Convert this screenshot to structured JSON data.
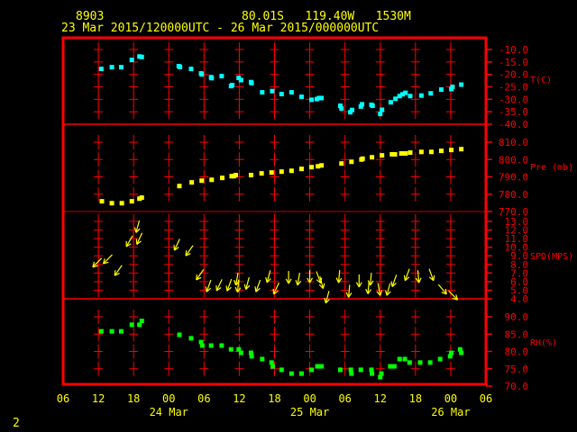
{
  "header": {
    "station": "8903",
    "location": "80.01S   119.40W   1530M",
    "time_range": "23 Mar 2015/120000UTC - 26 Mar 2015/000000UTC"
  },
  "page_number": "2",
  "colors": {
    "frame": "#ff0000",
    "text": "#ffff00",
    "temp": "#00ffff",
    "pressure": "#ffff00",
    "wind": "#ffff00",
    "rh": "#00ff00"
  },
  "chart_data": {
    "type": "scatter",
    "x_unit": "hours since 23 Mar 2015 06 UTC",
    "xlim": [
      0,
      72
    ],
    "x_ticks": [
      {
        "h": 0,
        "label": "06"
      },
      {
        "h": 6,
        "label": "12"
      },
      {
        "h": 12,
        "label": "18"
      },
      {
        "h": 18,
        "label": "00"
      },
      {
        "h": 24,
        "label": "06"
      },
      {
        "h": 30,
        "label": "12"
      },
      {
        "h": 36,
        "label": "18"
      },
      {
        "h": 42,
        "label": "00"
      },
      {
        "h": 48,
        "label": "06"
      },
      {
        "h": 54,
        "label": "12"
      },
      {
        "h": 60,
        "label": "18"
      },
      {
        "h": 66,
        "label": "00"
      },
      {
        "h": 72,
        "label": "06"
      }
    ],
    "date_labels": [
      {
        "h": 18,
        "label": "24 Mar"
      },
      {
        "h": 42,
        "label": "25 Mar"
      },
      {
        "h": 66,
        "label": "26 Mar"
      }
    ],
    "panels": [
      {
        "name": "temperature",
        "label": "T(C)",
        "ylim": [
          -40,
          -10
        ],
        "ticks": [
          "-10.0",
          "-15.0",
          "-20.0",
          "-25.0",
          "-30.0",
          "-35.0",
          "-40.0"
        ],
        "points": [
          [
            6.5,
            -17.8
          ],
          [
            8.3,
            -17.1
          ],
          [
            9.9,
            -17.1
          ],
          [
            11.7,
            -14.2
          ],
          [
            13.0,
            -12.8
          ],
          [
            13.4,
            -13.0
          ],
          [
            19.7,
            -16.7
          ],
          [
            19.9,
            -17.0
          ],
          [
            21.8,
            -17.8
          ],
          [
            23.5,
            -19.6
          ],
          [
            23.6,
            -20.0
          ],
          [
            25.2,
            -21.1
          ],
          [
            25.3,
            -21.5
          ],
          [
            27.0,
            -20.7
          ],
          [
            28.6,
            -24.7
          ],
          [
            28.8,
            -24.3
          ],
          [
            29.9,
            -21.4
          ],
          [
            30.3,
            -22.3
          ],
          [
            32.0,
            -23.1
          ],
          [
            32.1,
            -23.5
          ],
          [
            33.9,
            -27.2
          ],
          [
            35.6,
            -26.7
          ],
          [
            37.2,
            -27.9
          ],
          [
            38.9,
            -27.2
          ],
          [
            40.6,
            -29.0
          ],
          [
            42.3,
            -30.2
          ],
          [
            43.2,
            -29.9
          ],
          [
            43.6,
            -29.5
          ],
          [
            44.0,
            -29.5
          ],
          [
            47.2,
            -32.6
          ],
          [
            47.4,
            -33.7
          ],
          [
            48.9,
            -35.2
          ],
          [
            49.2,
            -34.3
          ],
          [
            50.7,
            -32.9
          ],
          [
            50.9,
            -32.0
          ],
          [
            52.5,
            -32.2
          ],
          [
            52.7,
            -32.6
          ],
          [
            54.0,
            -35.9
          ],
          [
            54.3,
            -34.2
          ],
          [
            55.8,
            -31.2
          ],
          [
            56.6,
            -29.8
          ],
          [
            57.3,
            -28.7
          ],
          [
            57.8,
            -28.0
          ],
          [
            58.3,
            -27.4
          ],
          [
            59.1,
            -28.7
          ],
          [
            61.0,
            -28.5
          ],
          [
            62.6,
            -27.6
          ],
          [
            64.4,
            -26.1
          ],
          [
            66.1,
            -25.9
          ],
          [
            66.3,
            -25.0
          ],
          [
            67.8,
            -24.1
          ]
        ]
      },
      {
        "name": "pressure",
        "label": "Pre (mb)",
        "ylim": [
          770,
          810
        ],
        "ticks": [
          "810.0",
          "800.0",
          "790.0",
          "780.0",
          "770.0"
        ],
        "points": [
          [
            6.6,
            775.9
          ],
          [
            8.3,
            774.8
          ],
          [
            10.0,
            774.8
          ],
          [
            11.7,
            775.9
          ],
          [
            13.0,
            777.4
          ],
          [
            13.4,
            778.0
          ],
          [
            19.8,
            784.7
          ],
          [
            21.9,
            786.8
          ],
          [
            23.6,
            787.8
          ],
          [
            25.3,
            788.3
          ],
          [
            27.1,
            789.4
          ],
          [
            28.7,
            790.4
          ],
          [
            29.1,
            790.4
          ],
          [
            29.4,
            791.0
          ],
          [
            32.0,
            791.0
          ],
          [
            33.8,
            792.0
          ],
          [
            35.5,
            792.5
          ],
          [
            37.2,
            793.0
          ],
          [
            38.9,
            793.5
          ],
          [
            40.6,
            794.6
          ],
          [
            42.3,
            795.6
          ],
          [
            43.4,
            796.1
          ],
          [
            44.0,
            796.6
          ],
          [
            47.4,
            797.7
          ],
          [
            49.1,
            798.7
          ],
          [
            50.8,
            800.0
          ],
          [
            51.0,
            800.5
          ],
          [
            52.6,
            801.3
          ],
          [
            54.3,
            802.4
          ],
          [
            56.0,
            803.0
          ],
          [
            56.5,
            803.0
          ],
          [
            57.6,
            803.5
          ],
          [
            58.3,
            803.5
          ],
          [
            59.1,
            804.0
          ],
          [
            61.0,
            804.4
          ],
          [
            62.7,
            804.4
          ],
          [
            64.4,
            805.0
          ],
          [
            66.1,
            805.5
          ],
          [
            67.8,
            806.0
          ]
        ]
      },
      {
        "name": "wind_speed",
        "label": "SPD(MPS)",
        "ylim": [
          4,
          13
        ],
        "ticks": [
          "13.0",
          "12.0",
          "11.0",
          "10.0",
          "9.0",
          "8.0",
          "7.0",
          "6.0",
          "5.0",
          "4.0"
        ],
        "points": [
          [
            5.8,
            8.2,
            225
          ],
          [
            7.6,
            8.6,
            225
          ],
          [
            9.4,
            7.3,
            215
          ],
          [
            11.3,
            10.7,
            210
          ],
          [
            12.7,
            12.4,
            195
          ],
          [
            13.0,
            11.0,
            205
          ],
          [
            19.4,
            10.3,
            205
          ],
          [
            21.5,
            9.6,
            215
          ],
          [
            23.3,
            6.8,
            215
          ],
          [
            24.8,
            5.5,
            200
          ],
          [
            26.6,
            5.6,
            205
          ],
          [
            28.3,
            5.6,
            200
          ],
          [
            29.6,
            6.3,
            190
          ],
          [
            29.8,
            5.5,
            185
          ],
          [
            31.4,
            5.8,
            195
          ],
          [
            33.2,
            5.5,
            200
          ],
          [
            35.0,
            6.6,
            195
          ],
          [
            36.3,
            5.2,
            205
          ],
          [
            38.4,
            6.5,
            180
          ],
          [
            40.1,
            6.3,
            190
          ],
          [
            42.0,
            6.6,
            180
          ],
          [
            43.5,
            6.5,
            160
          ],
          [
            44.0,
            5.9,
            165
          ],
          [
            45.0,
            4.2,
            195
          ],
          [
            47.0,
            6.6,
            185
          ],
          [
            48.7,
            4.9,
            185
          ],
          [
            50.4,
            6.1,
            180
          ],
          [
            52.0,
            5.3,
            185
          ],
          [
            52.4,
            6.3,
            185
          ],
          [
            53.8,
            5.1,
            170
          ],
          [
            55.4,
            5.1,
            195
          ],
          [
            56.4,
            6.1,
            200
          ],
          [
            58.6,
            6.8,
            200
          ],
          [
            60.5,
            6.6,
            175
          ],
          [
            62.7,
            6.8,
            160
          ],
          [
            64.6,
            5.1,
            140
          ],
          [
            66.4,
            4.4,
            135
          ]
        ]
      },
      {
        "name": "relative_humidity",
        "label": "RH(%)",
        "ylim": [
          70,
          90
        ],
        "ticks": [
          "90.0",
          "85.0",
          "80.0",
          "75.0",
          "70.0"
        ],
        "points": [
          [
            6.5,
            85.8
          ],
          [
            8.3,
            85.8
          ],
          [
            9.9,
            85.8
          ],
          [
            11.7,
            87.7
          ],
          [
            13.0,
            87.7
          ],
          [
            13.4,
            88.8
          ],
          [
            19.8,
            84.8
          ],
          [
            21.8,
            83.8
          ],
          [
            23.5,
            82.7
          ],
          [
            23.7,
            81.7
          ],
          [
            25.2,
            81.7
          ],
          [
            27.0,
            81.7
          ],
          [
            28.6,
            80.6
          ],
          [
            29.9,
            80.6
          ],
          [
            30.3,
            79.6
          ],
          [
            32.0,
            79.6
          ],
          [
            32.1,
            78.6
          ],
          [
            33.9,
            77.8
          ],
          [
            35.5,
            76.8
          ],
          [
            35.7,
            75.7
          ],
          [
            37.2,
            74.7
          ],
          [
            38.9,
            73.6
          ],
          [
            40.6,
            73.6
          ],
          [
            42.3,
            74.7
          ],
          [
            43.3,
            75.7
          ],
          [
            44.0,
            75.7
          ],
          [
            47.2,
            74.7
          ],
          [
            49.0,
            74.7
          ],
          [
            49.1,
            73.6
          ],
          [
            50.7,
            74.7
          ],
          [
            52.5,
            74.7
          ],
          [
            52.6,
            73.6
          ],
          [
            54.0,
            72.6
          ],
          [
            54.2,
            73.6
          ],
          [
            55.7,
            75.7
          ],
          [
            56.4,
            75.7
          ],
          [
            57.3,
            77.8
          ],
          [
            58.2,
            77.8
          ],
          [
            59.0,
            76.8
          ],
          [
            60.8,
            76.8
          ],
          [
            62.5,
            76.8
          ],
          [
            64.2,
            77.8
          ],
          [
            65.9,
            78.6
          ],
          [
            66.1,
            79.6
          ],
          [
            67.6,
            80.6
          ],
          [
            67.8,
            79.6
          ]
        ]
      }
    ]
  }
}
